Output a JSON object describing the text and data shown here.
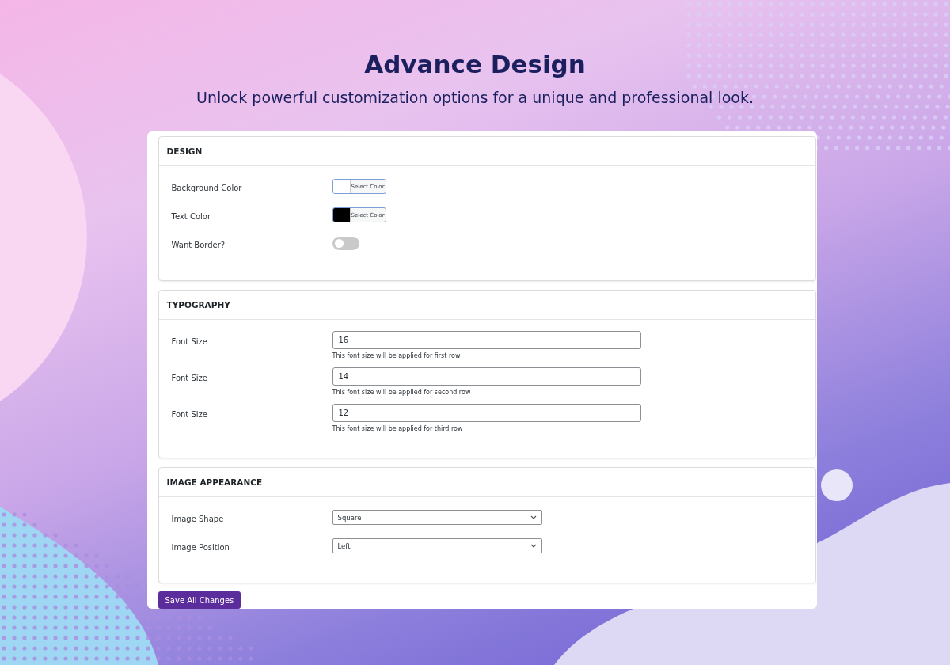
{
  "header": {
    "title": "Advance Design",
    "subtitle": "Unlock powerful customization options for a unique and professional look."
  },
  "sections": [
    {
      "title": "DESIGN",
      "fields": [
        {
          "kind": "color",
          "label": "Background Color",
          "color": "#ffffff",
          "button": "Select Color"
        },
        {
          "kind": "color",
          "label": "Text Color",
          "color": "#000000",
          "button": "Select Color"
        },
        {
          "kind": "toggle",
          "label": "Want Border?",
          "on": false
        }
      ]
    },
    {
      "title": "TYPOGRAPHY",
      "fields": [
        {
          "kind": "text",
          "label": "Font Size",
          "value": "16",
          "hint": "This font size will be applied for first row"
        },
        {
          "kind": "text",
          "label": "Font Size",
          "value": "14",
          "hint": "This font size will be applied for second row"
        },
        {
          "kind": "text",
          "label": "Font Size",
          "value": "12",
          "hint": "This font size will be applied for third row"
        }
      ]
    },
    {
      "title": "IMAGE APPEARANCE",
      "fields": [
        {
          "kind": "select",
          "label": "Image Shape",
          "value": "Square"
        },
        {
          "kind": "select",
          "label": "Image Position",
          "value": "Left"
        }
      ]
    }
  ],
  "save_button": "Save All Changes"
}
